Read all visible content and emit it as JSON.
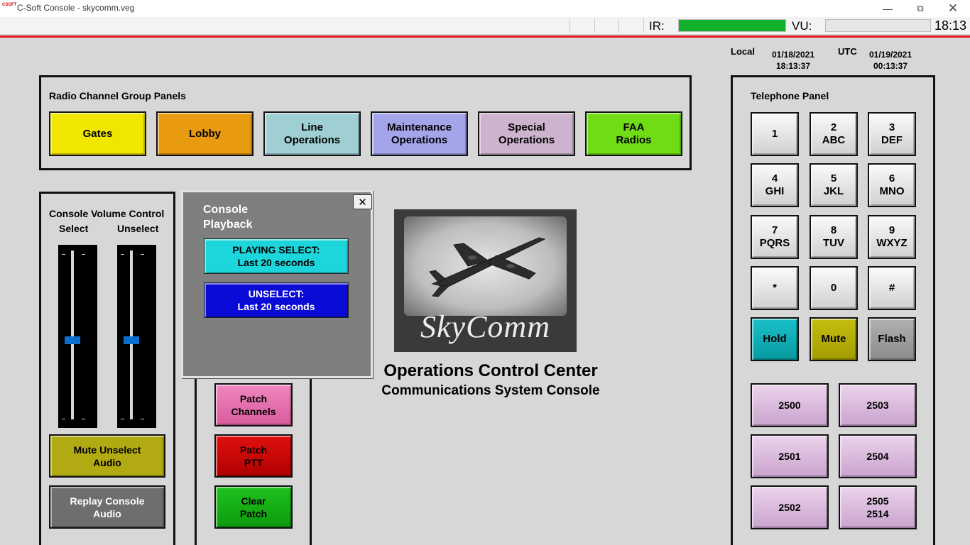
{
  "window": {
    "title": "C-Soft Console - skycomm.veg",
    "icon_text": "CSOFT",
    "minimize_icon": "minimize-icon",
    "restore_icon": "restore-icon",
    "close_icon": "close-icon"
  },
  "status": {
    "ir_label": "IR:",
    "ir_level_percent": 100,
    "vu_label": "VU:",
    "vu_level_percent": 0,
    "clock": "18:13"
  },
  "time": {
    "local_label": "Local",
    "local_date": "01/18/2021",
    "local_time": "18:13:37",
    "utc_label": "UTC",
    "utc_date": "01/19/2021",
    "utc_time": "00:13:37"
  },
  "radio_panel": {
    "title": "Radio Channel Group Panels",
    "buttons": [
      {
        "label": "Gates",
        "color": "#f0e600"
      },
      {
        "label": "Lobby",
        "color": "#e89a10"
      },
      {
        "label": "Line\nOperations",
        "color": "#9fcfd3"
      },
      {
        "label": "Maintenance\nOperations",
        "color": "#a4a4ea"
      },
      {
        "label": "Special\nOperations",
        "color": "#cdb3cd"
      },
      {
        "label": "FAA\nRadios",
        "color": "#6fdc16"
      }
    ]
  },
  "volume_panel": {
    "title": "Console Volume Control",
    "select_label": "Select",
    "unselect_label": "Unselect",
    "select_level_percent": 47,
    "unselect_level_percent": 47,
    "mute_button": "Mute Unselect\nAudio",
    "replay_button": "Replay Console\nAudio"
  },
  "patch_panel": {
    "patch_channels": "Patch\nChannels",
    "patch_ptt": "Patch\nPTT",
    "clear_patch": "Clear\nPatch"
  },
  "popup": {
    "title": "Console\nPlayback",
    "close_label": "✕",
    "playing_select": "PLAYING SELECT:\nLast 20 seconds",
    "unselect": "UNSELECT:\nLast 20 seconds"
  },
  "center": {
    "logo_text": "SkyComm",
    "title": "Operations Control Center",
    "subtitle": "Communications System Console"
  },
  "telephone": {
    "title": "Telephone Panel",
    "keys": [
      "1",
      "2\nABC",
      "3\nDEF",
      "4\nGHI",
      "5\nJKL",
      "6\nMNO",
      "7\nPQRS",
      "8\nTUV",
      "9\nWXYZ",
      "*",
      "0",
      "#"
    ],
    "hold": "Hold",
    "mute": "Mute",
    "flash": "Flash",
    "extensions": [
      "2500",
      "2503",
      "2501",
      "2504",
      "2502",
      "2505\n2514"
    ]
  }
}
